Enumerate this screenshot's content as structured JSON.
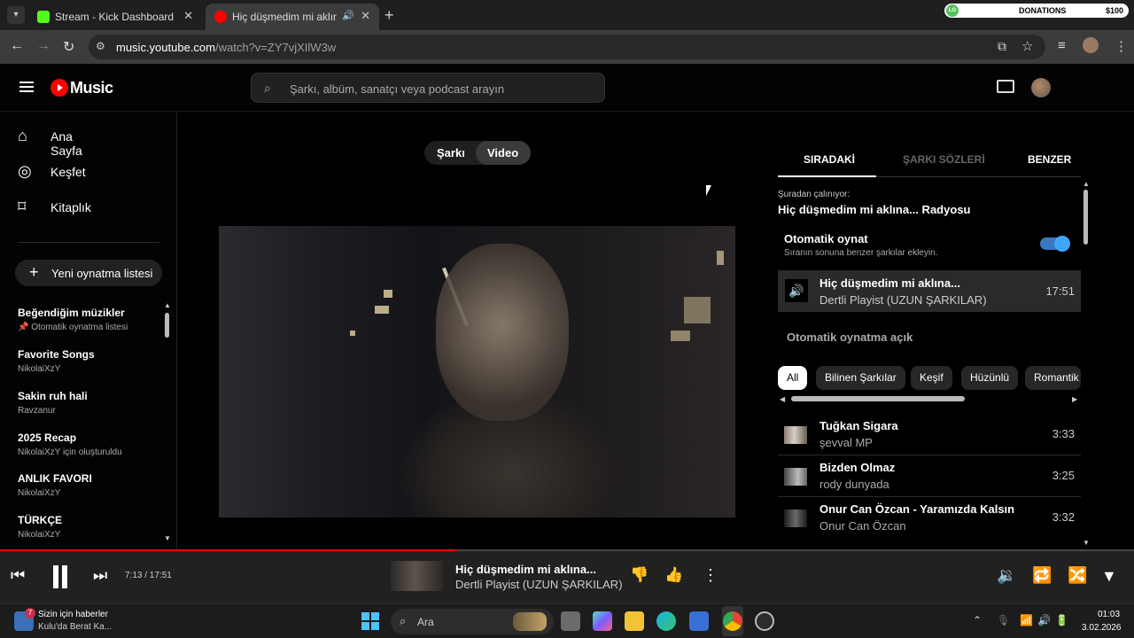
{
  "browser": {
    "tabs": [
      {
        "title": "Stream - Kick Dashboard",
        "close": "✕"
      },
      {
        "title": "Hiç düşmedim mi aklına... |",
        "close": "✕"
      }
    ],
    "url_host": "music.youtube.com",
    "url_path": "/watch?v=ZY7vjXIlW3w",
    "donations_label": "DONATIONS",
    "donations_amount": "$100",
    "donations_avatar": "LG"
  },
  "header": {
    "logo": "Music",
    "search_placeholder": "Şarkı, albüm, sanatçı veya podcast arayın"
  },
  "sidebar": {
    "nav": [
      {
        "label": "Ana Sayfa"
      },
      {
        "label": "Keşfet"
      },
      {
        "label": "Kitaplık"
      }
    ],
    "new_playlist": "Yeni oynatma listesi",
    "playlists": [
      {
        "title": "Beğendiğim müzikler",
        "sub": "Otomatik oynatma listesi",
        "pinned": true
      },
      {
        "title": "Favorite Songs",
        "sub": "NikolaiXzY"
      },
      {
        "title": "Sakin ruh hali",
        "sub": "Ravzanur"
      },
      {
        "title": "2025 Recap",
        "sub": "NikolaiXzY için oluşturuldu"
      },
      {
        "title": "ANLIK FAVORI",
        "sub": "NikolaiXzY"
      },
      {
        "title": "TÜRKÇE",
        "sub": "NikolaiXzY"
      }
    ]
  },
  "main": {
    "toggle": {
      "song": "Şarkı",
      "video": "Video"
    }
  },
  "panel": {
    "tabs": [
      "SIRADAKİ",
      "ŞARKI SÖZLERİ",
      "BENZER"
    ],
    "playing_from_label": "Şuradan çalınıyor:",
    "playing_from": "Hiç düşmedim mi aklına... Radyosu",
    "autoplay_title": "Otomatik oynat",
    "autoplay_sub": "Sıranın sonuna benzer şarkılar ekleyin.",
    "autoplay_on": true,
    "current": {
      "title": "Hiç düşmedim mi aklına...",
      "artist": "Dertli Playist (UZUN ŞARKILAR)",
      "duration": "17:51"
    },
    "autoplay_status": "Otomatik oynatma açık",
    "chips": [
      "All",
      "Bilinen Şarkılar",
      "Keşif",
      "Hüzünlü",
      "Romantik"
    ],
    "queue": [
      {
        "title": "Tuğkan Sigara",
        "artist": "şevval MP",
        "duration": "3:33"
      },
      {
        "title": "Bizden Olmaz",
        "artist": "rody dunyada",
        "duration": "3:25"
      },
      {
        "title": "Onur Can Özcan - Yaramızda Kalsın",
        "artist": "Onur Can Özcan",
        "duration": "3:32"
      }
    ]
  },
  "player": {
    "time": "7:13 / 17:51",
    "progress": 0.404,
    "title": "Hiç düşmedim mi aklına...",
    "artist": "Dertli Playist (UZUN ŞARKILAR)"
  },
  "taskbar": {
    "news_title": "Sizin için haberler",
    "news_sub": "Kulu'da Berat Ka...",
    "news_badge": "7",
    "search": "Ara",
    "time": "01:03",
    "date": "3.02.2026"
  },
  "colors": {
    "accent": "#ff0000",
    "toggle": "#3ea6ff",
    "background": "#030303"
  }
}
